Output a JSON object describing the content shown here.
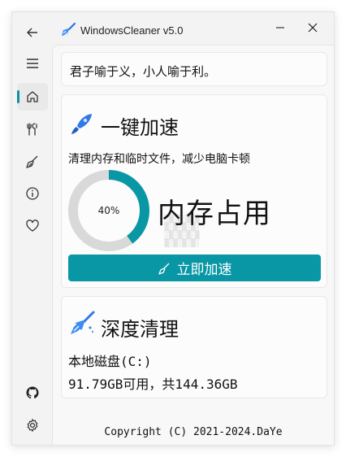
{
  "window": {
    "title": "WindowsCleaner v5.0"
  },
  "nav": {
    "items": [
      {
        "name": "back",
        "icon": "back-arrow-icon"
      },
      {
        "name": "menu",
        "icon": "hamburger-menu-icon"
      },
      {
        "name": "home",
        "icon": "home-icon",
        "active": true
      },
      {
        "name": "tools",
        "icon": "tools-icon"
      },
      {
        "name": "clean",
        "icon": "broom-icon"
      },
      {
        "name": "about",
        "icon": "info-icon"
      },
      {
        "name": "favorite",
        "icon": "heart-icon"
      },
      {
        "name": "github",
        "icon": "github-icon"
      },
      {
        "name": "settings",
        "icon": "gear-icon"
      }
    ],
    "accent_color": "#0f8fa0"
  },
  "motto": "君子喻于义，小人喻于利。",
  "quick_boost": {
    "title": "一键加速",
    "description": "清理内存和临时文件，减少电脑卡顿",
    "memory_usage_percent": 40,
    "memory_usage_text": "40%",
    "memory_label": "内存占用",
    "button_label": "立即加速",
    "button_color": "#0a97a5"
  },
  "deep_clean": {
    "title": "深度清理",
    "disk_name": "本地磁盘(C:)",
    "disk_info": "91.79GB可用，共144.36GB"
  },
  "footer": {
    "copyright": "Copyright (C) 2021-2024.DaYe"
  }
}
